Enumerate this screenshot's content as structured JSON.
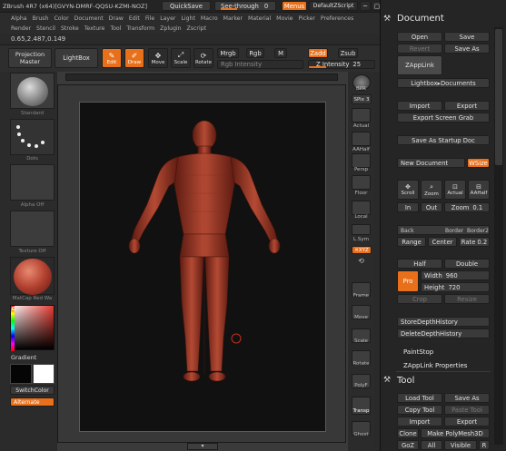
{
  "title": {
    "app": "ZBrush 4R7 (x64)[GVYN-DMRF-QQSU-KZMI-NOZ]",
    "quicksave": "QuickSave",
    "seethrough_label": "See-through",
    "seethrough_value": "0",
    "menus": "Menus",
    "defaultzscript": "DefaultZScript"
  },
  "menus": {
    "row1": [
      "Alpha",
      "Brush",
      "Color",
      "Document",
      "Draw",
      "Edit",
      "File",
      "Layer",
      "Light",
      "Macro",
      "Marker",
      "Material",
      "Movie",
      "Picker",
      "Preferences"
    ],
    "row2": [
      "Render",
      "Stencil",
      "Stroke",
      "Texture",
      "Tool",
      "Transform",
      "Zplugin",
      "Zscript"
    ]
  },
  "coords": "0.65,2.487,0.149",
  "toolbar": {
    "projection": "Projection Master",
    "lightbox": "LightBox",
    "edit": "Edit",
    "draw": "Draw",
    "move": "Move",
    "scale": "Scale",
    "rotate": "Rotate",
    "mrgb": "Mrgb",
    "rgb": "Rgb",
    "m": "M",
    "rgb_intensity": "Rgb Intensity",
    "zadd": "Zadd",
    "zsub": "Zsub",
    "z_intensity_label": "Z Intensity",
    "z_intensity_value": "25"
  },
  "left": {
    "standard": "Standard",
    "dots": "Dots",
    "alpha_off": "Alpha Off",
    "texture_off": "Texture Off",
    "matcap": "MatCap Red Wa",
    "gradient": "Gradient",
    "switchcolor": "SwitchColor",
    "alternate": "Alternate"
  },
  "rightstrip": {
    "bpr": "BPR",
    "spix_label": "SPix",
    "spix_value": "3",
    "actual": "Actual",
    "aahalf": "AAHalf",
    "persp": "Persp",
    "floor": "Floor",
    "local": "Local",
    "lsym": "L.Sym",
    "xyz": "✕XYZ",
    "frame": "Frame",
    "move": "Move",
    "scale": "Scale",
    "rotate": "Rotate",
    "polyf": "PolyF",
    "transp": "Transp",
    "ghost": "Ghost"
  },
  "document": {
    "title": "Document",
    "open": "Open",
    "save": "Save",
    "revert": "Revert",
    "save_as": "Save As",
    "zapplink": "ZAppLink",
    "lightbox_docs": "Lightbox▸Documents",
    "import": "Import",
    "export": "Export",
    "export_screen_grab": "Export Screen Grab",
    "save_startup": "Save As Startup Doc",
    "new_document": "New Document",
    "wsize": "WSize",
    "scroll": "Scroll",
    "zoom": "Zoom",
    "actual": "Actual",
    "aahalf": "AAHalf",
    "in": "In",
    "out": "Out",
    "zoom_label": "Zoom",
    "zoom_value": "0.1",
    "back": "Back",
    "border": "Border",
    "border2": "Border2",
    "range": "Range",
    "center": "Center",
    "rate_label": "Rate",
    "rate_value": "0.2",
    "half": "Half",
    "double": "Double",
    "pro": "Pro",
    "width_label": "Width",
    "width_value": "960",
    "height_label": "Height",
    "height_value": "720",
    "crop": "Crop",
    "resize": "Resize",
    "storedepth": "StoreDepthHistory",
    "deletedepth": "DeleteDepthHistory",
    "paintstop": "PaintStop",
    "zapplink_props": "ZAppLink Properties"
  },
  "tool": {
    "title": "Tool",
    "load_tool": "Load Tool",
    "save_as": "Save As",
    "copy_tool": "Copy Tool",
    "paste_tool": "Paste Tool",
    "import": "Import",
    "export": "Export",
    "clone": "Clone",
    "make_polymesh": "Make PolyMesh3D",
    "goz": "GoZ",
    "all": "All",
    "visible": "Visible",
    "r": "R"
  },
  "colors": {
    "accent": "#e8701a",
    "background": "#2a2a2a",
    "figure": "#a03a28"
  }
}
